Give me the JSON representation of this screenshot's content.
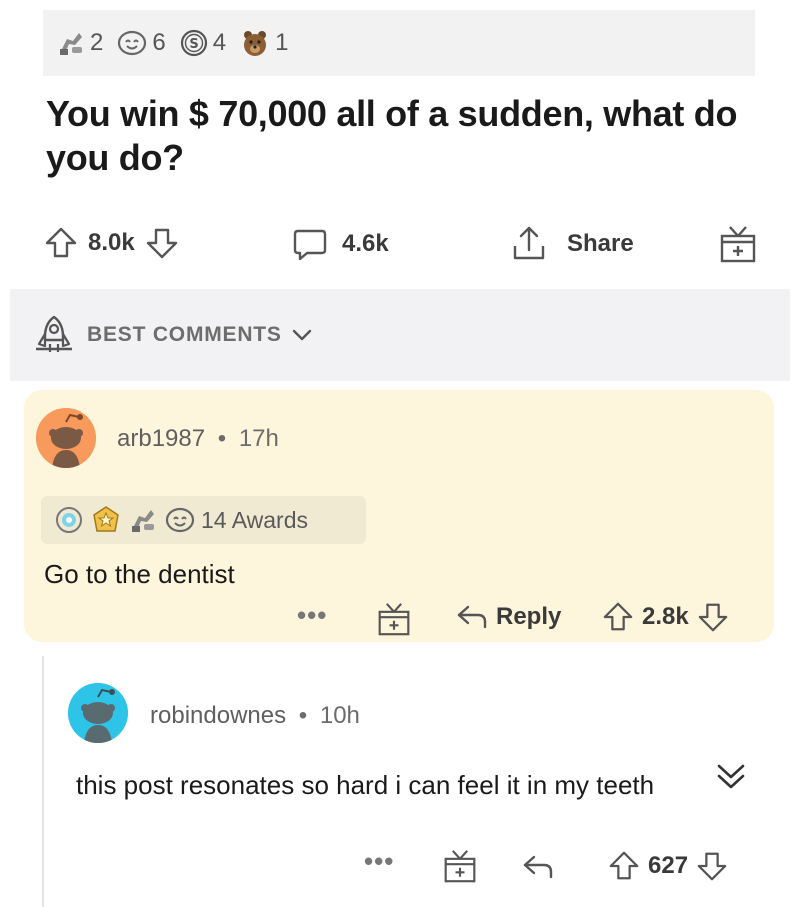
{
  "awards_bar": {
    "items": [
      {
        "icon": "helpful-award-icon",
        "count": "2"
      },
      {
        "icon": "wholesome-award-icon",
        "count": "6"
      },
      {
        "icon": "silver-award-icon",
        "count": "4"
      },
      {
        "icon": "bear-award-icon",
        "count": "1"
      }
    ]
  },
  "post": {
    "title": "You win $ 70,000 all of a sudden, what do you do?",
    "upvotes": "8.0k",
    "comments": "4.6k",
    "share_label": "Share"
  },
  "sort": {
    "label": "BEST COMMENTS"
  },
  "comments": [
    {
      "username": "arb1987",
      "separator": "•",
      "age": "17h",
      "awards_label": "14 Awards",
      "body": "Go to the dentist",
      "more": "•••",
      "reply_label": "Reply",
      "score": "2.8k",
      "avatar_color": "#f79a5b"
    },
    {
      "username": "robindownes",
      "separator": "•",
      "age": "10h",
      "body": "this post resonates so hard i can feel it in my teeth",
      "more": "•••",
      "score": "627",
      "avatar_color": "#2ec4e8"
    }
  ],
  "colors": {
    "highlight_bg": "#fdf5dc",
    "section_bg": "#f2f2f4",
    "icon_gray": "#555555"
  }
}
